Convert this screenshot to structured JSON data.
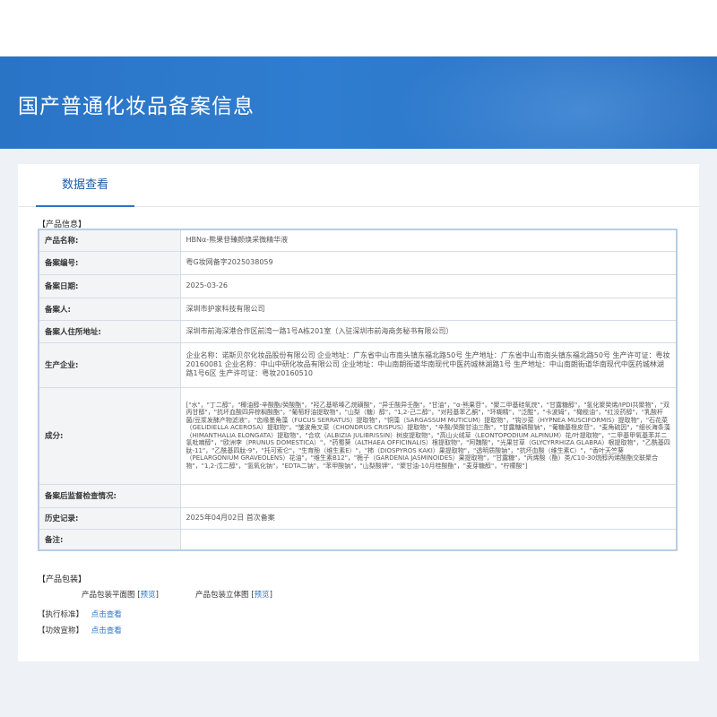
{
  "banner": {
    "title": "国产普通化妆品备案信息"
  },
  "tab": {
    "label": "数据查看"
  },
  "sections": {
    "product_info": "【产品信息】",
    "packaging": "【产品包装】",
    "standard": "【执行标准】",
    "efficacy": "【功效宣称】"
  },
  "product": {
    "rows": [
      {
        "label": "产品名称:",
        "value": "HBNα-熊果苷臻颜焕采微精华液"
      },
      {
        "label": "备案编号:",
        "value": "粤G妆网备字2025038059"
      },
      {
        "label": "备案日期:",
        "value": "2025-03-26"
      },
      {
        "label": "备案人:",
        "value": "深圳市护家科技有限公司"
      },
      {
        "label": "备案人住所地址:",
        "value": "深圳市前海深港合作区前湾一路1号A栋201室（入驻深圳市前海商务秘书有限公司）"
      },
      {
        "label": "生产企业:",
        "value": "企业名称：诺斯贝尔化妆品股份有限公司 企业地址：广东省中山市南头镇东福北路50号 生产地址：广东省中山市南头镇东福北路50号 生产许可证：粤妆20160081 企业名称：中山中研化妆品有限公司 企业地址：中山南朗街道华南现代中医药城林湖路1号 生产地址：中山南朗街道华南现代中医药城林湖路1号6区 生产许可证：粤妆20160510"
      },
      {
        "label": "成分:",
        "value": "[\"水\"，\"丁二醇\"，\"椰油醇-辛酸酯/癸酸酯\"，\"羟乙基哌嗪乙烷磺酸\"，\"异壬酸异壬酯\"，\"甘油\"，\"α-熊果苷\"，\"聚二甲基硅氧烷\"，\"甘露糖醇\"，\"氢化聚癸烯/IPDI共聚物\"，\"双丙甘醇\"，\"抗坏血酸四异棕榈酸酯\"，\"葡萄籽油提取物\"，\"山梨（糖）醇\"，\"1,2-己二醇\"，\"对羟基苯乙酮\"，\"环糊精\"，\"泛醌\"，\"卡波姆\"，\"橄榄油\"，\"红没药醇\"，\"乳酸杆菌/豆浆发酵产物滤液\"，\"齿缘墨角藻（FUCUS SERRATUS）提取物\"，\"铜藻（SARGASSUM MUTICUM）提取物\"，\"钩沙菜（HYPNEA MUSCIFORMIS）提取物\"，\"石花菜（GELIDIELLA ACEROSA）提取物\"，\"皱波角叉菜（CHONDRUS CRISPUS）提取物\"，\"辛酸/癸酸甘油三酯\"，\"甘露糖磷酸钠\"，\"葡糖基橙皮苷\"，\"麦角硫因\"，\"细长海条藻（HIMANTHALIA ELONGATA）提取物\"，\"合欢（ALBIZIA JULIBRISSIN）树皮提取物\"，\"高山火绒草（LEONTOPODIUM ALPINUM）花/叶提取物\"，\"二甲基甲氧基苯并二氢吡喃醇\"，\"欧洲李（PRUNUS DOMESTICA）\"，\"药蜀葵（ALTHAEA OFFICINALIS）根提取物\"，\"阿魏酸\"，\"光果甘草（GLYCYRRHIZA GLABRA）根提取物\"，\"乙酰基四肽-11\"，\"乙酰基四肽-9\"，\"托可索仑\"，\"生育酚（维生素E）\"，\"柿（DIOSPYROS KAKI）果提取物\"，\"透明质酸钠\"，\"抗坏血酸（维生素C）\"，\"香叶天竺葵（PELARGONIUM GRAVEOLENS）花油\"，\"维生素B12\"，\"栀子（GARDENIA JASMINOIDES）果提取物\"，\"甘露糖\"，\"丙烯酸（酯）类/C10-30烷醇丙烯酸酯交联聚合物\"，\"1,2-戊二醇\"，\"氢氧化钠\"，\"EDTA二钠\"，\"苯甲酸钠\"，\"山梨酸钾\"，\"聚甘油-10月桂酸酯\"，\"麦芽糖醇\"，\"柠檬酸\"]"
      },
      {
        "label": "备案后监督检查情况:",
        "value": ""
      },
      {
        "label": "历史记录:",
        "value": "2025年04月02日 首次备案"
      },
      {
        "label": "备注:",
        "value": ""
      }
    ]
  },
  "packaging": {
    "flat_label": "产品包装平面图",
    "solid_label": "产品包装立体图",
    "bracket_open": "[",
    "bracket_close": "]",
    "preview": "预览"
  },
  "standard": {
    "link": "点击查看"
  },
  "efficacy": {
    "link": "点击查看"
  }
}
